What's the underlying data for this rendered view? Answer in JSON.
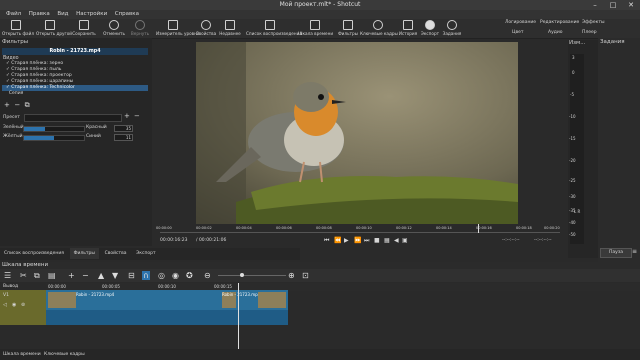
{
  "window": {
    "title": "Мой проект.mlt* - Shotcut"
  },
  "menu": [
    "Файл",
    "Правка",
    "Вид",
    "Настройки",
    "Справка"
  ],
  "toolbar": [
    "Открыть файл",
    "Открыть другой",
    "Сохранить",
    "Отменить",
    "Вернуть",
    "Измеритель уровня",
    "Свойства",
    "Недавнее",
    "Список воспроизведения",
    "Шкала времени",
    "Фильтры",
    "Ключевые кадры",
    "История",
    "Экспорт",
    "Задания"
  ],
  "toolbar_right": {
    "tabs": [
      "Логирование",
      "Редактирование",
      "Эффекты"
    ],
    "sub": [
      "Цвет",
      "Аудио",
      "Плеер"
    ]
  },
  "filters": {
    "header": "Фильтры",
    "clip_name": "Robin - 21723.mp4",
    "section": "Видео",
    "items": [
      "Старая плёнка: зерно",
      "Старая плёнка: пыль",
      "Старая плёнка: проектор",
      "Старая плёнка: царапины",
      "Старая плёнка: Technicolor",
      "Сепия"
    ],
    "selected_index": 4,
    "preset_label": "Пресет",
    "sliders": [
      {
        "label": "Зелёный",
        "sub": "Красный",
        "value": "35",
        "fill": 0.35
      },
      {
        "label": "Жёлтый",
        "sub": "Синий",
        "value": "11",
        "fill": 0.5
      }
    ]
  },
  "player": {
    "timecode_current": "00:00:16:23",
    "timecode_total": "/ 00:00:21:06",
    "ruler": [
      "00:00:00",
      "00:00:02",
      "00:00:04",
      "00:00:06",
      "00:00:08",
      "00:00:10",
      "00:00:12",
      "00:00:14",
      "00:00:16",
      "00:00:18",
      "00:00:20"
    ],
    "in_point": "--:--:--:--",
    "out_point": "--:--:--:--",
    "tab_source": "Исходный",
    "tab_project": "Проект",
    "zoom_note": "Масштаб предпросмотра на 720p"
  },
  "meters": {
    "title": "Изм...",
    "scale": [
      "3",
      "0",
      "-5",
      "-10",
      "-15",
      "-20",
      "-25",
      "-30",
      "-35",
      "-40",
      "-50"
    ],
    "lr": "L  R"
  },
  "right_panel": {
    "title": "Задания",
    "pause": "Пауза"
  },
  "bottom_tabs": [
    "Список воспроизведения",
    "Фильтры",
    "Свойства",
    "Экспорт"
  ],
  "timeline": {
    "header": "Шкала времени",
    "track_output": "Вывод",
    "track_name": "V1",
    "ruler": [
      "00:00:00",
      "00:00:05",
      "00:00:10",
      "00:00:15"
    ],
    "clip_label": "Robin - 21723.mp4"
  },
  "status_tabs": [
    "Шкала времени",
    "Ключевые кадры"
  ]
}
